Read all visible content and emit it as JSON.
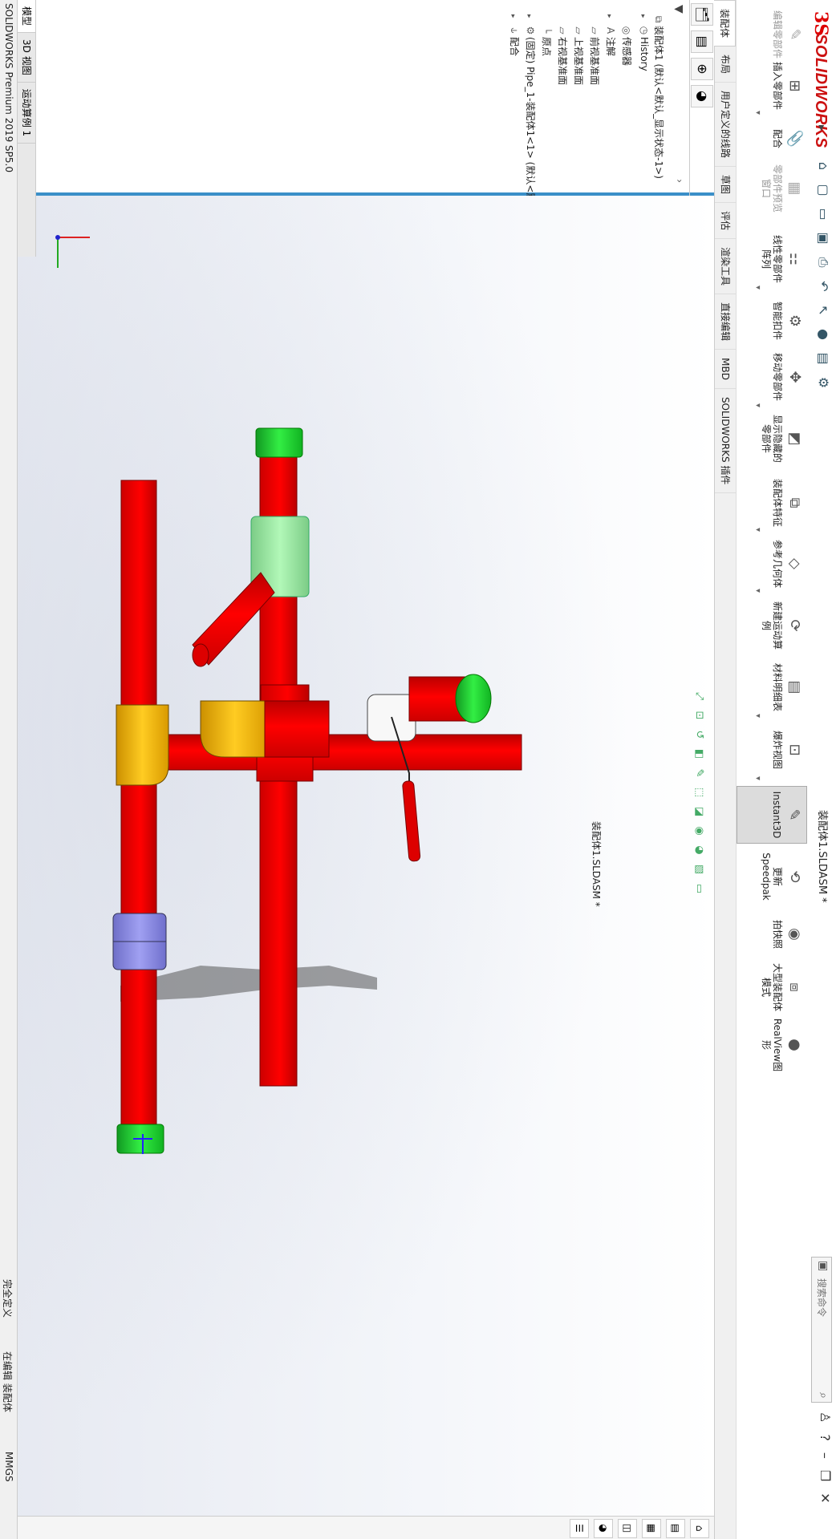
{
  "app": {
    "brand": "SOLIDWORKS",
    "doc_title": "装配体1.SLDASM *",
    "search_placeholder": "搜索命令"
  },
  "ribbon": {
    "buttons": [
      {
        "label": "编辑零部件",
        "icon": "edit-component-icon",
        "state": "gray"
      },
      {
        "label": "插入零部件",
        "icon": "insert-component-icon",
        "state": "normal"
      },
      {
        "label": "配合",
        "icon": "mate-icon",
        "state": "normal"
      },
      {
        "label": "零部件预览窗口",
        "icon": "component-preview-icon",
        "state": "gray"
      },
      {
        "label": "线性零部件阵列",
        "icon": "linear-pattern-icon",
        "state": "normal"
      },
      {
        "label": "智能扣件",
        "icon": "smart-fasteners-icon",
        "state": "normal"
      },
      {
        "label": "移动零部件",
        "icon": "move-component-icon",
        "state": "normal"
      },
      {
        "label": "显示隐藏的零部件",
        "icon": "show-hidden-icon",
        "state": "normal"
      },
      {
        "label": "装配体特征",
        "icon": "assembly-features-icon",
        "state": "normal"
      },
      {
        "label": "参考几何体",
        "icon": "reference-geometry-icon",
        "state": "normal"
      },
      {
        "label": "新建运动算例",
        "icon": "new-motion-study-icon",
        "state": "normal"
      },
      {
        "label": "材料明细表",
        "icon": "bom-icon",
        "state": "normal"
      },
      {
        "label": "爆炸视图",
        "icon": "exploded-view-icon",
        "state": "normal"
      },
      {
        "label": "Instant3D",
        "icon": "instant3d-icon",
        "state": "active"
      },
      {
        "label": "更新Speedpak",
        "icon": "speedpak-icon",
        "state": "normal"
      },
      {
        "label": "拍快照",
        "icon": "snapshot-icon",
        "state": "normal"
      },
      {
        "label": "大型装配体模式",
        "icon": "large-assembly-icon",
        "state": "normal"
      },
      {
        "label": "RealView图形",
        "icon": "realview-icon",
        "state": "normal"
      }
    ]
  },
  "tabs": [
    "装配体",
    "布局",
    "用户定义的线路",
    "草图",
    "评估",
    "渲染工具",
    "直接编辑",
    "MBD",
    "SOLIDWORKS 插件"
  ],
  "feature_tree": {
    "items": [
      {
        "label": "装配体1 (默认<默认_显示状态-1>)",
        "icon": "assembly-icon",
        "indent": 0,
        "toggle": ""
      },
      {
        "label": "History",
        "icon": "history-icon",
        "indent": 1,
        "toggle": "▸"
      },
      {
        "label": "传感器",
        "icon": "sensor-icon",
        "indent": 1,
        "toggle": ""
      },
      {
        "label": "注解",
        "icon": "annotation-icon",
        "indent": 1,
        "toggle": "▸"
      },
      {
        "label": "前视基准面",
        "icon": "plane-icon",
        "indent": 1,
        "toggle": ""
      },
      {
        "label": "上视基准面",
        "icon": "plane-icon",
        "indent": 1,
        "toggle": ""
      },
      {
        "label": "右视基准面",
        "icon": "plane-icon",
        "indent": 1,
        "toggle": ""
      },
      {
        "label": "原点",
        "icon": "origin-icon",
        "indent": 1,
        "toggle": ""
      },
      {
        "label": "(固定) Pipe_1-装配体1<1> (默认<默",
        "icon": "part-icon",
        "indent": 1,
        "toggle": "▸"
      },
      {
        "label": "配合",
        "icon": "mates-icon",
        "indent": 1,
        "toggle": "▸"
      }
    ]
  },
  "status": {
    "version": "SOLIDWORKS Premium 2019 SP5.0",
    "defined": "完全定义",
    "editing": "在编辑 装配体",
    "units": "MMGS"
  },
  "bottom_tabs": [
    "模型",
    "3D 视图",
    "运动算例 1"
  ],
  "colors": {
    "pipe": "#ee0000",
    "fitting_green": "#22dd33",
    "fitting_yellow": "#f6bb00",
    "fitting_lightgreen": "#9ef0a6",
    "fitting_lavender": "#8c8ce6",
    "accent": "#3a8fc8"
  }
}
